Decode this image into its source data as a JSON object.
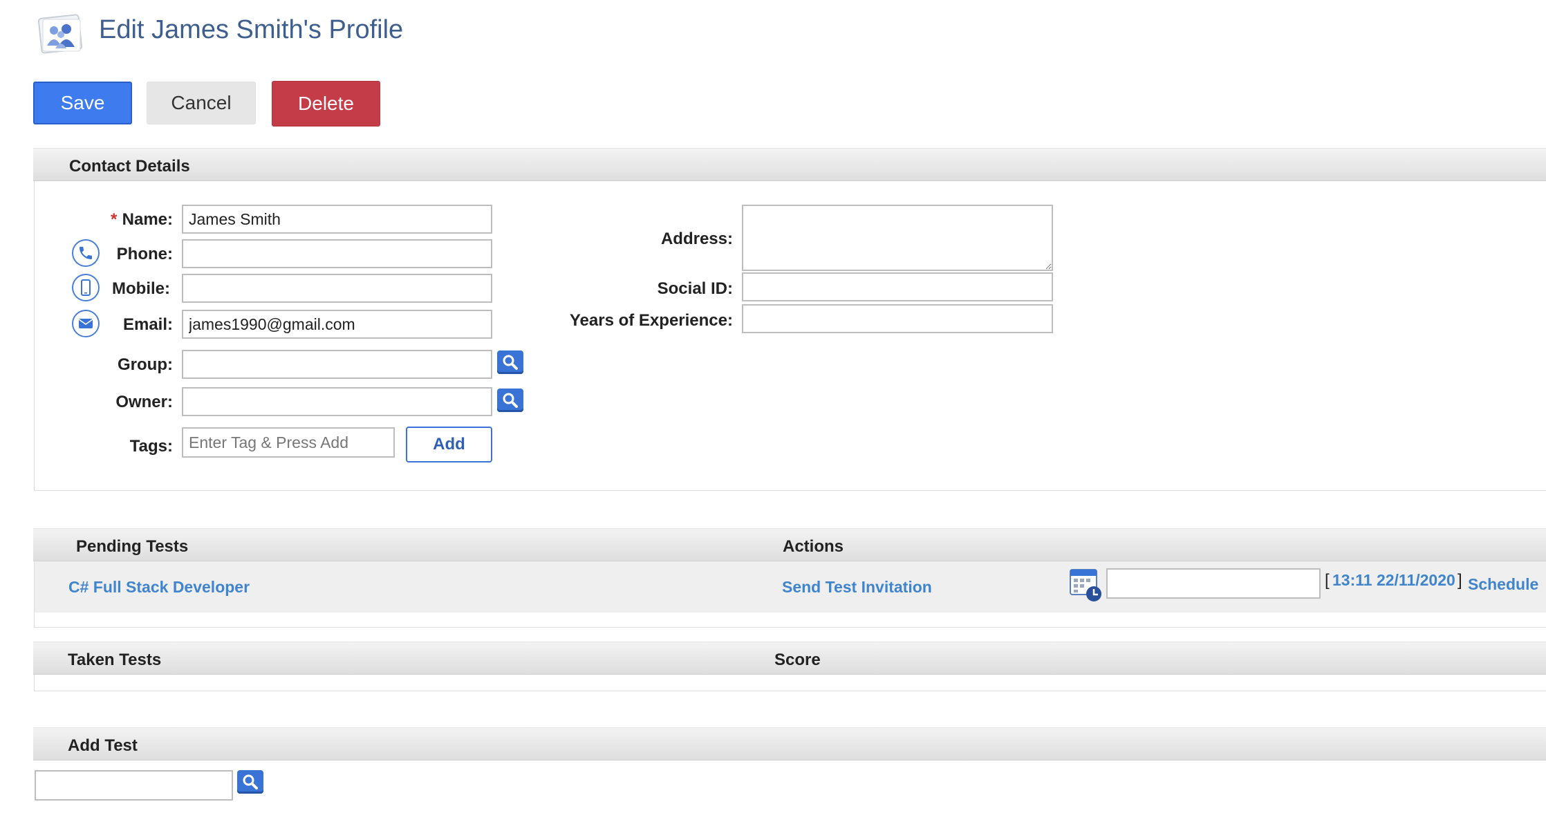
{
  "header": {
    "title": "Edit James Smith's Profile"
  },
  "toolbar": {
    "save_label": "Save",
    "cancel_label": "Cancel",
    "delete_label": "Delete"
  },
  "contact": {
    "section_title": "Contact Details",
    "required_mark": "*",
    "name_label": "Name:",
    "name_value": "James Smith",
    "phone_label": "Phone:",
    "phone_value": "",
    "mobile_label": "Mobile:",
    "mobile_value": "",
    "email_label": "Email:",
    "email_value": "james1990@gmail.com",
    "group_label": "Group:",
    "group_value": "",
    "owner_label": "Owner:",
    "owner_value": "",
    "tags_label": "Tags:",
    "tags_placeholder": "Enter Tag & Press Add",
    "add_tag_label": "Add",
    "address_label": "Address:",
    "address_value": "",
    "social_id_label": "Social ID:",
    "social_id_value": "",
    "experience_label": "Years of Experience:",
    "experience_value": ""
  },
  "pending_tests": {
    "col_tests": "Pending Tests",
    "col_actions": "Actions",
    "rows": [
      {
        "test_name": "C# Full Stack Developer",
        "action_label": "Send Test Invitation",
        "schedule_value": "",
        "bracket_open": "[",
        "bracket_close": "]",
        "datetime": "13:11 22/11/2020",
        "schedule_label": "Schedule"
      }
    ]
  },
  "taken_tests": {
    "col_tests": "Taken Tests",
    "col_score": "Score"
  },
  "add_test": {
    "title": "Add Test",
    "value": ""
  },
  "icons": {
    "logo": "profile-users-icon",
    "phone": "phone-icon",
    "mobile": "mobile-icon",
    "email": "envelope-icon",
    "search": "search-icon",
    "calendar": "calendar-clock-icon"
  },
  "colors": {
    "title": "#3e5e8e",
    "primary": "#3d7bef",
    "danger": "#c33c48",
    "link": "#3f84cc",
    "icon_blue": "#3a73d6"
  }
}
